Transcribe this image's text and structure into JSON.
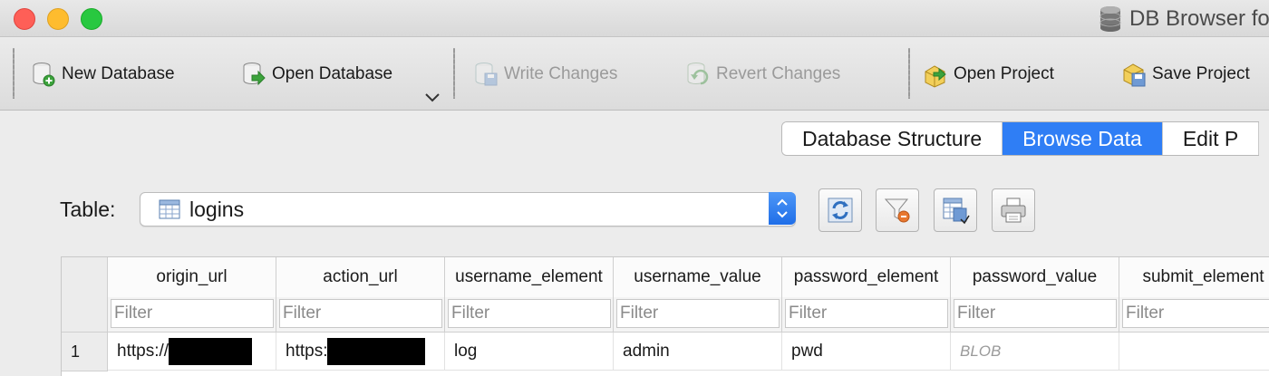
{
  "window": {
    "title": "DB Browser fo"
  },
  "toolbar": {
    "new_database": "New Database",
    "open_database": "Open Database",
    "write_changes": "Write Changes",
    "revert_changes": "Revert Changes",
    "open_project": "Open Project",
    "save_project": "Save Project"
  },
  "tabs": [
    {
      "label": "Database Structure",
      "active": false
    },
    {
      "label": "Browse Data",
      "active": true
    },
    {
      "label": "Edit P",
      "active": false
    }
  ],
  "browse": {
    "table_label": "Table:",
    "table_value": "logins"
  },
  "grid": {
    "columns": [
      "origin_url",
      "action_url",
      "username_element",
      "username_value",
      "password_element",
      "password_value",
      "submit_element"
    ],
    "filter_placeholder": "Filter",
    "rows": [
      {
        "row_number": "1",
        "origin_url": "https://",
        "action_url": "https:",
        "username_element": "log",
        "username_value": "admin",
        "password_element": "pwd",
        "password_value": "BLOB",
        "submit_element": ""
      }
    ]
  },
  "colors": {
    "accent": "#2f7ef5",
    "close": "#fe5f57",
    "minimize": "#febc2e",
    "zoom": "#28c840"
  }
}
